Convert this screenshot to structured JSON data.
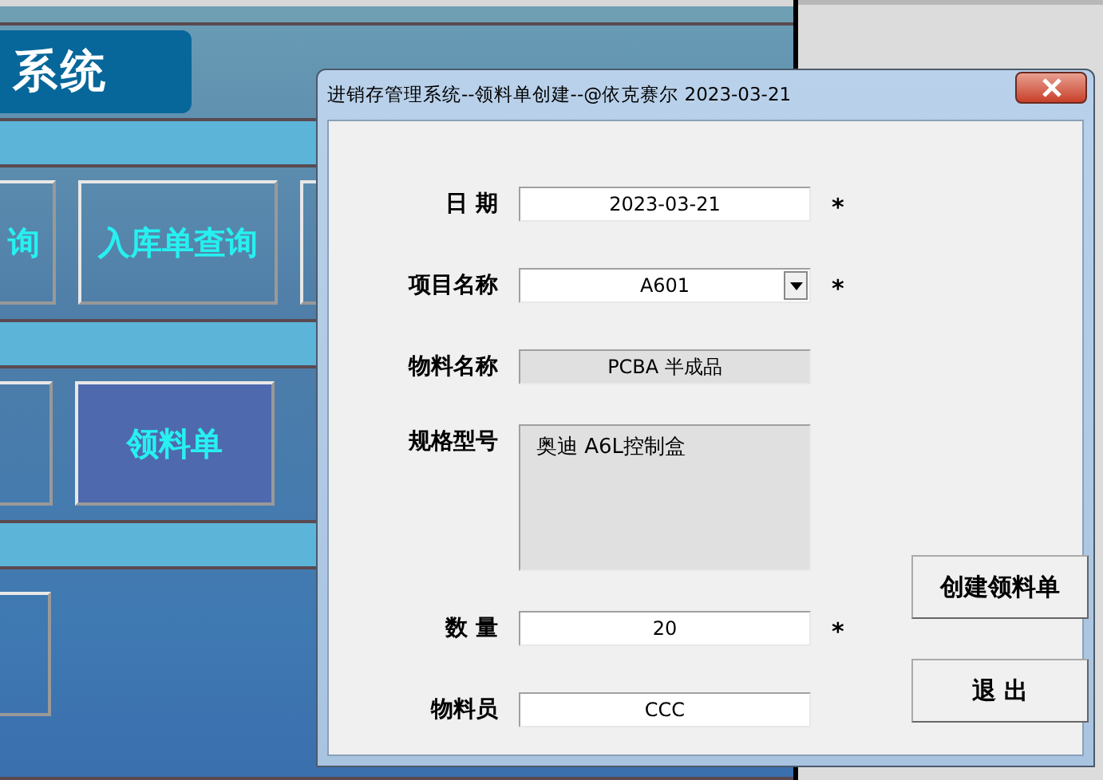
{
  "background": {
    "banner_title": "系统",
    "button_rows": [
      [
        {
          "label": "询",
          "highlighted": false
        },
        {
          "label": "入库单查询",
          "highlighted": false
        },
        {
          "highlighted": false
        }
      ],
      [
        {
          "highlighted": false
        },
        {
          "label": "领料单",
          "highlighted": true
        }
      ],
      [
        {
          "highlighted": false
        }
      ]
    ]
  },
  "dialog": {
    "title": "进销存管理系统--领料单创建--@依克赛尔 2023-03-21",
    "fields": [
      {
        "label": "日 期",
        "kind": "text",
        "value": "2023-03-21",
        "required_mark": "*"
      },
      {
        "label": "项目名称",
        "kind": "dropdown",
        "value": "A601",
        "required_mark": "*"
      },
      {
        "label": "物料名称",
        "kind": "readonly",
        "value": "PCBA 半成品"
      },
      {
        "label": "规格型号",
        "kind": "textarea",
        "value": "奥迪 A6L控制盒"
      },
      {
        "label": "数 量",
        "kind": "text",
        "value": "20",
        "required_mark": "*"
      },
      {
        "label": "物料员",
        "kind": "text",
        "value": "CCC"
      }
    ],
    "buttons": [
      "创建领料单",
      "退 出"
    ]
  }
}
